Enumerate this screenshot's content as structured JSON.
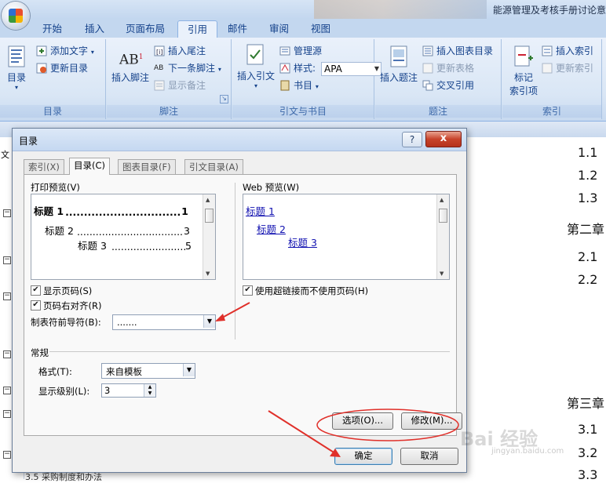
{
  "app": {
    "doc_title": "能源管理及考核手册讨论意"
  },
  "ribbon": {
    "tabs": [
      {
        "label": "开始"
      },
      {
        "label": "插入"
      },
      {
        "label": "页面布局"
      },
      {
        "label": "引用"
      },
      {
        "label": "邮件"
      },
      {
        "label": "审阅"
      },
      {
        "label": "视图"
      }
    ],
    "active_tab": "引用",
    "groups": {
      "toc": {
        "label": "目录",
        "toc_button": "目录",
        "add_text": "添加文字",
        "update_toc": "更新目录"
      },
      "footnote": {
        "label": "脚注",
        "insert_footnote": "插入脚注",
        "insert_endnote": "插入尾注",
        "next_footnote": "下一条脚注",
        "show_notes": "显示备注"
      },
      "citation": {
        "label": "引文与书目",
        "insert_citation": "插入引文",
        "manage_sources": "管理源",
        "style_label": "样式:",
        "style_value": "APA",
        "bibliography": "书目"
      },
      "caption": {
        "label": "题注",
        "insert_caption": "插入题注",
        "insert_table_of_figures": "插入图表目录",
        "update_table": "更新表格",
        "cross_reference": "交叉引用"
      },
      "index": {
        "label": "索引",
        "mark_entry_line1": "标记",
        "mark_entry_line2": "索引项",
        "insert_index": "插入索引",
        "update_index": "更新索引"
      }
    }
  },
  "left_pane": {
    "text": "文"
  },
  "document": {
    "lines": [
      {
        "text": "1.1"
      },
      {
        "text": "1.2"
      },
      {
        "text": "1.3"
      },
      {
        "text": "第二章"
      },
      {
        "text": "2.1"
      },
      {
        "text": "2.2"
      },
      {
        "text": "第三章"
      },
      {
        "text": "3.1"
      },
      {
        "text": "3.2"
      },
      {
        "text": "3.3"
      }
    ],
    "bottom_text": "3.5 采购制度和办法"
  },
  "dialog": {
    "title": "目录",
    "help": "?",
    "close": "x",
    "tabs": [
      {
        "label": "索引(X)"
      },
      {
        "label": "目录(C)"
      },
      {
        "label": "图表目录(F)"
      },
      {
        "label": "引文目录(A)"
      }
    ],
    "print_preview": {
      "label": "打印预览(V)",
      "lines": [
        {
          "text": "标题 1",
          "page": "1"
        },
        {
          "text": "标题 2",
          "page": "3"
        },
        {
          "text": "标题 3",
          "page": "5"
        }
      ]
    },
    "web_preview": {
      "label": "Web 预览(W)",
      "links": [
        "标题 1",
        "标题 2",
        "标题 3"
      ]
    },
    "show_page_numbers": {
      "label": "显示页码(S)",
      "checked": true
    },
    "right_align": {
      "label": "页码右对齐(R)",
      "checked": true
    },
    "tab_leader": {
      "label": "制表符前导符(B):",
      "value": "......."
    },
    "use_hyperlinks": {
      "label": "使用超链接而不使用页码(H)",
      "checked": true
    },
    "general": {
      "label": "常规",
      "format_label": "格式(T):",
      "format_value": "来自模板",
      "levels_label": "显示级别(L):",
      "levels_value": "3"
    },
    "buttons": {
      "options": "选项(O)...",
      "modify": "修改(M)...",
      "ok": "确定",
      "cancel": "取消"
    }
  },
  "watermark": {
    "text": "Bai 经验",
    "sub": "jingyan.baidu.com"
  },
  "colors": {
    "annotation_red": "#e0302a",
    "link_blue": "#1010b0",
    "ribbon_text": "#15428b"
  }
}
